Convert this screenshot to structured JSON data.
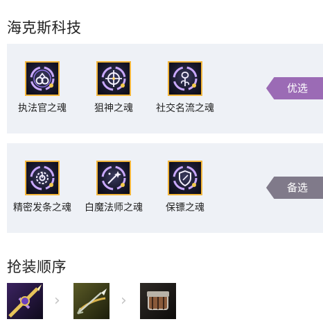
{
  "hero_name": "海克斯科技",
  "primary": {
    "tag": "优选",
    "tag_color": "#9b6bb5",
    "emblems": [
      {
        "name": "执法官之魂",
        "icon": "handcuffs-icon"
      },
      {
        "name": "狙神之魂",
        "icon": "crosshair-icon"
      },
      {
        "name": "社交名流之魂",
        "icon": "rose-icon"
      }
    ]
  },
  "secondary": {
    "tag": "备选",
    "tag_color": "#807a8a",
    "emblems": [
      {
        "name": "精密发条之魂",
        "icon": "clockwork-icon"
      },
      {
        "name": "白魔法师之魂",
        "icon": "magic-wand-icon"
      },
      {
        "name": "保镖之魂",
        "icon": "shield-icon"
      }
    ]
  },
  "build_order": {
    "title": "抢装顺序",
    "items": [
      {
        "icon": "golden-spear-icon"
      },
      {
        "icon": "arrow-bow-icon"
      },
      {
        "icon": "armored-gauntlet-icon"
      }
    ],
    "separator": "›"
  }
}
